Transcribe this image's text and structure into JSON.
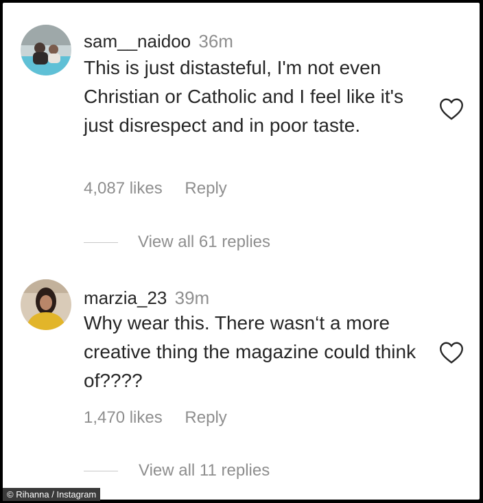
{
  "comments": [
    {
      "username": "sam__naidoo",
      "time": "36m",
      "text": "This is just distasteful, I'm not even Christian or Catholic and I feel like it's just disrespect and in poor taste.",
      "likes": "4,087 likes",
      "reply_label": "Reply",
      "view_replies": "View all 61 replies",
      "like_icon": "heart-outline-icon"
    },
    {
      "username": "marzia_23",
      "time": "39m",
      "text": "Why wear this. There wasn‘t a more creative thing the magazine could think of????",
      "likes": "1,470 likes",
      "reply_label": "Reply",
      "view_replies": "View all 11 replies",
      "like_icon": "heart-outline-icon"
    }
  ],
  "credit": "© Rihanna / Instagram",
  "colors": {
    "text": "#262626",
    "secondary": "#8e8e8e",
    "background": "#ffffff",
    "frame": "#000000"
  }
}
